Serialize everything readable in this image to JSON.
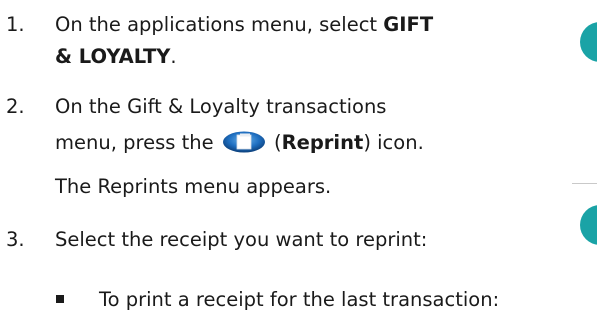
{
  "steps": [
    {
      "number": "1.",
      "line1_pre": "On the applications menu, select ",
      "line1_bold": "GIFT",
      "line2_bold": "& LOYALTY",
      "line2_post": "."
    },
    {
      "number": "2.",
      "line1": "On the Gift & Loyalty transactions",
      "line2_pre": "menu, press the",
      "open_paren": " (",
      "bold": "Reprint",
      "line2_post": ") icon.",
      "note": "The Reprints menu appears."
    },
    {
      "number": "3.",
      "line1": "Select the receipt you want to reprint:"
    }
  ],
  "bullet": {
    "text": "To print a receipt for the last transaction:"
  },
  "icons": {
    "reprint": "reprint-icon",
    "side_markers": "teal-circle-icon"
  },
  "colors": {
    "text": "#1a1a1a",
    "marker": "#1aa3a6",
    "rule": "#c9c9c9"
  }
}
